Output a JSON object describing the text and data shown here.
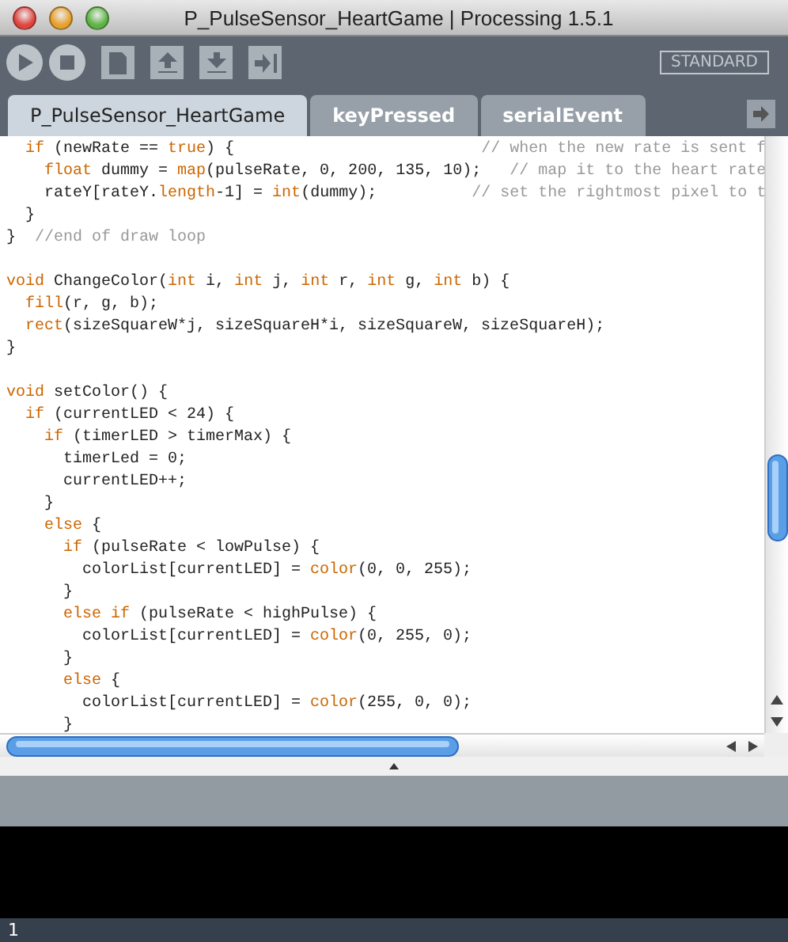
{
  "window": {
    "title": "P_PulseSensor_HeartGame | Processing 1.5.1"
  },
  "toolbar": {
    "buttons": [
      {
        "kind": "run"
      },
      {
        "kind": "stop"
      },
      {
        "kind": "new"
      },
      {
        "kind": "open"
      },
      {
        "kind": "save"
      },
      {
        "kind": "export"
      }
    ],
    "mode": "STANDARD"
  },
  "tabs": [
    {
      "label": "P_PulseSensor_HeartGame",
      "selected": true
    },
    {
      "label": "keyPressed",
      "selected": false
    },
    {
      "label": "serialEvent",
      "selected": false
    }
  ],
  "editor": {
    "lines": [
      {
        "kind": "code",
        "segments": [
          {
            "kind": "keyword",
            "text": "  if"
          },
          {
            "kind": "plain",
            "text": " (newRate == "
          },
          {
            "kind": "keyword",
            "text": "true"
          },
          {
            "kind": "plain",
            "text": ") {                          "
          },
          {
            "kind": "comment",
            "text": "// when the new rate is sent f"
          }
        ]
      },
      {
        "kind": "code",
        "segments": [
          {
            "kind": "keyword",
            "text": "    float"
          },
          {
            "kind": "plain",
            "text": " dummy = "
          },
          {
            "kind": "keyword",
            "text": "map"
          },
          {
            "kind": "plain",
            "text": "(pulseRate, 0, 200, 135, 10);   "
          },
          {
            "kind": "comment",
            "text": "// map it to the heart rate"
          }
        ]
      },
      {
        "kind": "code",
        "segments": [
          {
            "kind": "plain",
            "text": "    rateY[rateY."
          },
          {
            "kind": "keyword",
            "text": "length"
          },
          {
            "kind": "plain",
            "text": "-1] = "
          },
          {
            "kind": "keyword",
            "text": "int"
          },
          {
            "kind": "plain",
            "text": "(dummy);          "
          },
          {
            "kind": "comment",
            "text": "// set the rightmost pixel to t"
          }
        ]
      },
      {
        "kind": "code",
        "segments": [
          {
            "kind": "plain",
            "text": "  }"
          }
        ]
      },
      {
        "kind": "code",
        "segments": [
          {
            "kind": "plain",
            "text": "}  "
          },
          {
            "kind": "comment",
            "text": "//end of draw loop"
          }
        ]
      },
      {
        "kind": "blank"
      },
      {
        "kind": "code",
        "segments": [
          {
            "kind": "keyword",
            "text": "void"
          },
          {
            "kind": "plain",
            "text": " ChangeColor("
          },
          {
            "kind": "keyword",
            "text": "int"
          },
          {
            "kind": "plain",
            "text": " i, "
          },
          {
            "kind": "keyword",
            "text": "int"
          },
          {
            "kind": "plain",
            "text": " j, "
          },
          {
            "kind": "keyword",
            "text": "int"
          },
          {
            "kind": "plain",
            "text": " r, "
          },
          {
            "kind": "keyword",
            "text": "int"
          },
          {
            "kind": "plain",
            "text": " g, "
          },
          {
            "kind": "keyword",
            "text": "int"
          },
          {
            "kind": "plain",
            "text": " b) {"
          }
        ]
      },
      {
        "kind": "code",
        "segments": [
          {
            "kind": "keyword",
            "text": "  fill"
          },
          {
            "kind": "plain",
            "text": "(r, g, b);"
          }
        ]
      },
      {
        "kind": "code",
        "segments": [
          {
            "kind": "keyword",
            "text": "  rect"
          },
          {
            "kind": "plain",
            "text": "(sizeSquareW*j, sizeSquareH*i, sizeSquareW, sizeSquareH);"
          }
        ]
      },
      {
        "kind": "code",
        "segments": [
          {
            "kind": "plain",
            "text": "}"
          }
        ]
      },
      {
        "kind": "blank"
      },
      {
        "kind": "code",
        "segments": [
          {
            "kind": "keyword",
            "text": "void"
          },
          {
            "kind": "plain",
            "text": " setColor() {"
          }
        ]
      },
      {
        "kind": "code",
        "segments": [
          {
            "kind": "keyword",
            "text": "  if"
          },
          {
            "kind": "plain",
            "text": " (currentLED < 24) {"
          }
        ]
      },
      {
        "kind": "code",
        "segments": [
          {
            "kind": "keyword",
            "text": "    if"
          },
          {
            "kind": "plain",
            "text": " (timerLED > timerMax) {"
          }
        ]
      },
      {
        "kind": "code",
        "segments": [
          {
            "kind": "plain",
            "text": "      timerLed = 0;"
          }
        ]
      },
      {
        "kind": "code",
        "segments": [
          {
            "kind": "plain",
            "text": "      currentLED++;"
          }
        ]
      },
      {
        "kind": "code",
        "segments": [
          {
            "kind": "plain",
            "text": "    }"
          }
        ]
      },
      {
        "kind": "code",
        "segments": [
          {
            "kind": "keyword",
            "text": "    else"
          },
          {
            "kind": "plain",
            "text": " {"
          }
        ]
      },
      {
        "kind": "code",
        "segments": [
          {
            "kind": "keyword",
            "text": "      if"
          },
          {
            "kind": "plain",
            "text": " (pulseRate < lowPulse) {"
          }
        ]
      },
      {
        "kind": "code",
        "segments": [
          {
            "kind": "plain",
            "text": "        colorList[currentLED] = "
          },
          {
            "kind": "keyword",
            "text": "color"
          },
          {
            "kind": "plain",
            "text": "(0, 0, 255);"
          }
        ]
      },
      {
        "kind": "code",
        "segments": [
          {
            "kind": "plain",
            "text": "      }"
          }
        ]
      },
      {
        "kind": "code",
        "segments": [
          {
            "kind": "keyword",
            "text": "      else if"
          },
          {
            "kind": "plain",
            "text": " (pulseRate < highPulse) {"
          }
        ]
      },
      {
        "kind": "code",
        "segments": [
          {
            "kind": "plain",
            "text": "        colorList[currentLED] = "
          },
          {
            "kind": "keyword",
            "text": "color"
          },
          {
            "kind": "plain",
            "text": "(0, 255, 0);"
          }
        ]
      },
      {
        "kind": "code",
        "segments": [
          {
            "kind": "plain",
            "text": "      }"
          }
        ]
      },
      {
        "kind": "code",
        "segments": [
          {
            "kind": "keyword",
            "text": "      else"
          },
          {
            "kind": "plain",
            "text": " {"
          }
        ]
      },
      {
        "kind": "code",
        "segments": [
          {
            "kind": "plain",
            "text": "        colorList[currentLED] = "
          },
          {
            "kind": "keyword",
            "text": "color"
          },
          {
            "kind": "plain",
            "text": "(255, 0, 0);"
          }
        ]
      },
      {
        "kind": "code",
        "segments": [
          {
            "kind": "plain",
            "text": "      }"
          }
        ]
      }
    ]
  },
  "status_bar": {
    "line": "1"
  }
}
